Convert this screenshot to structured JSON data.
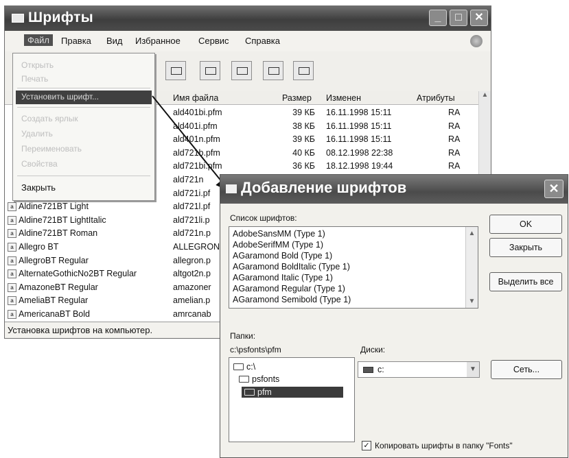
{
  "window": {
    "title": "Шрифты",
    "menu": [
      "Файл",
      "Правка",
      "Вид",
      "Избранное",
      "Сервис",
      "Справка"
    ],
    "columns": [
      "Имя файла",
      "Размер",
      "Изменен",
      "Атрибуты"
    ],
    "status": "Установка шрифтов на компьютер.",
    "rows": [
      {
        "file": "ald401bi.pfm",
        "size": "39 КБ",
        "modified": "16.11.1998 15:11",
        "attr": "RA"
      },
      {
        "file": "ald401i.pfm",
        "size": "38 КБ",
        "modified": "16.11.1998 15:11",
        "attr": "RA"
      },
      {
        "file": "ald401n.pfm",
        "size": "39 КБ",
        "modified": "16.11.1998 15:11",
        "attr": "RA"
      },
      {
        "file": "ald721b.pfm",
        "size": "40 КБ",
        "modified": "08.12.1998 22:38",
        "attr": "RA"
      },
      {
        "file": "ald721bi.pfm",
        "size": "36 КБ",
        "modified": "18.12.1998 19:44",
        "attr": "RA"
      },
      {
        "file": "ald721n",
        "size": "",
        "modified": "",
        "attr": ""
      },
      {
        "file": "ald721i.pf",
        "size": "",
        "modified": "",
        "attr": ""
      },
      {
        "name": "Aldine721BT Light",
        "file": "ald721l.pf",
        "size": "",
        "modified": "",
        "attr": ""
      },
      {
        "name": "Aldine721BT LightItalic",
        "file": "ald721li.p",
        "size": "",
        "modified": "",
        "attr": ""
      },
      {
        "name": "Aldine721BT Roman",
        "file": "ald721n.p",
        "size": "",
        "modified": "",
        "attr": ""
      },
      {
        "name": "Allegro BT",
        "file": "ALLEGRON",
        "size": "",
        "modified": "",
        "attr": ""
      },
      {
        "name": "AllegroBT Regular",
        "file": "allegron.p",
        "size": "",
        "modified": "",
        "attr": ""
      },
      {
        "name": "AlternateGothicNo2BT Regular",
        "file": "altgot2n.p",
        "size": "",
        "modified": "",
        "attr": ""
      },
      {
        "name": "AmazoneBT Regular",
        "file": "amazoner",
        "size": "",
        "modified": "",
        "attr": ""
      },
      {
        "name": "AmeliaBT Regular",
        "file": "amelian.p",
        "size": "",
        "modified": "",
        "attr": ""
      },
      {
        "name": "AmericanaBT Bold",
        "file": "amrcanab",
        "size": "",
        "modified": "",
        "attr": ""
      }
    ]
  },
  "file_menu": {
    "items": [
      "Открыть",
      "Печать",
      "Установить шрифт...",
      "Создать ярлык",
      "Удалить",
      "Переименовать",
      "Свойства",
      "Закрыть"
    ]
  },
  "dialog": {
    "title": "Добавление шрифтов",
    "font_list_label": "Список шрифтов:",
    "fonts": [
      "AdobeSansMM (Type 1)",
      "AdobeSerifMM (Type 1)",
      "AGaramond Bold (Type 1)",
      "AGaramond BoldItalic (Type 1)",
      "AGaramond Italic (Type 1)",
      "AGaramond Regular (Type 1)",
      "AGaramond Semibold (Type 1)"
    ],
    "ok_label": "OK",
    "close_label": "Закрыть",
    "select_all_label": "Выделить все",
    "folders_label": "Папки:",
    "folder_path": "c:\\psfonts\\pfm",
    "folders": [
      "c:\\",
      "psfonts",
      "pfm"
    ],
    "drives_label": "Диски:",
    "drive_value": "c:",
    "network_label": "Сеть...",
    "copy_checkbox_label": "Копировать шрифты в папку \"Fonts\"",
    "copy_checked": true
  }
}
